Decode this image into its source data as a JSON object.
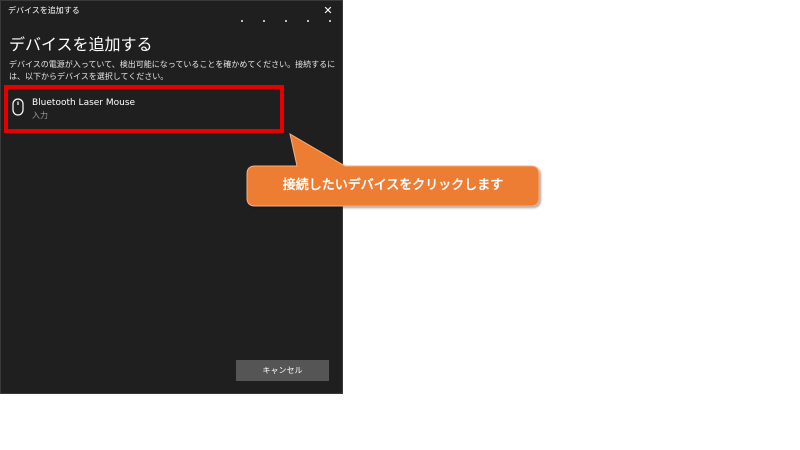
{
  "window": {
    "title": "デバイスを追加する",
    "close_glyph": "✕"
  },
  "dialog": {
    "heading": "デバイスを追加する",
    "description": "デバイスの電源が入っていて、検出可能になっていることを確かめてください。接続するには、以下からデバイスを選択してください。"
  },
  "devices": [
    {
      "name": "Bluetooth Laser Mouse",
      "type": "入力",
      "icon": "mouse-icon"
    }
  ],
  "buttons": {
    "cancel_label": "キャンセル"
  },
  "annotation": {
    "callout_text": "接続したいデバイスをクリックします"
  },
  "colors": {
    "dialog_background": "#1f1f1f",
    "highlight_border": "#e60000",
    "callout_fill": "#ed7d31",
    "cancel_button": "#555555",
    "secondary_text": "#9a9a9a"
  }
}
